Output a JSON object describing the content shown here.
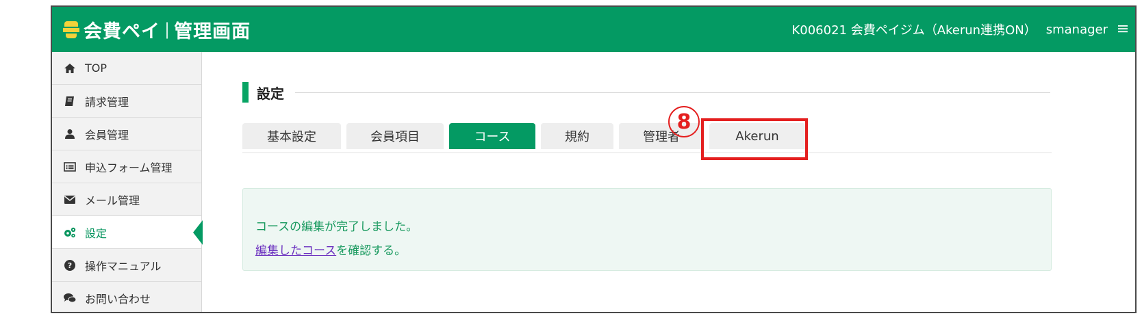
{
  "header": {
    "app_title": "会費ペイ",
    "app_section": "管理画面",
    "separator": "|",
    "account_info": "K006021 会費ペイジム（Akerun連携ON）",
    "username": "smanager",
    "menu_icon": "hamburger-icon",
    "background_color": "#049a63"
  },
  "sidebar": {
    "items": [
      {
        "label": "TOP",
        "icon": "home-icon"
      },
      {
        "label": "請求管理",
        "icon": "book-icon"
      },
      {
        "label": "会員管理",
        "icon": "user-icon"
      },
      {
        "label": "申込フォーム管理",
        "icon": "list-icon"
      },
      {
        "label": "メール管理",
        "icon": "envelope-icon"
      },
      {
        "label": "設定",
        "icon": "gears-icon",
        "active": true
      },
      {
        "label": "操作マニュアル",
        "icon": "question-icon"
      },
      {
        "label": "お問い合わせ",
        "icon": "chat-icon"
      }
    ]
  },
  "main": {
    "section_title": "設定",
    "tabs": [
      {
        "label": "基本設定"
      },
      {
        "label": "会員項目"
      },
      {
        "label": "コース",
        "active": true
      },
      {
        "label": "規約"
      },
      {
        "label": "管理者"
      },
      {
        "label": "Akerun",
        "highlighted": true
      }
    ],
    "annotation": {
      "step_number": "8",
      "color": "#e41f1f"
    },
    "notice": {
      "message": "コースの編集が完了しました。",
      "link_text": "編集したコース",
      "link_suffix": "を確認する。"
    }
  }
}
